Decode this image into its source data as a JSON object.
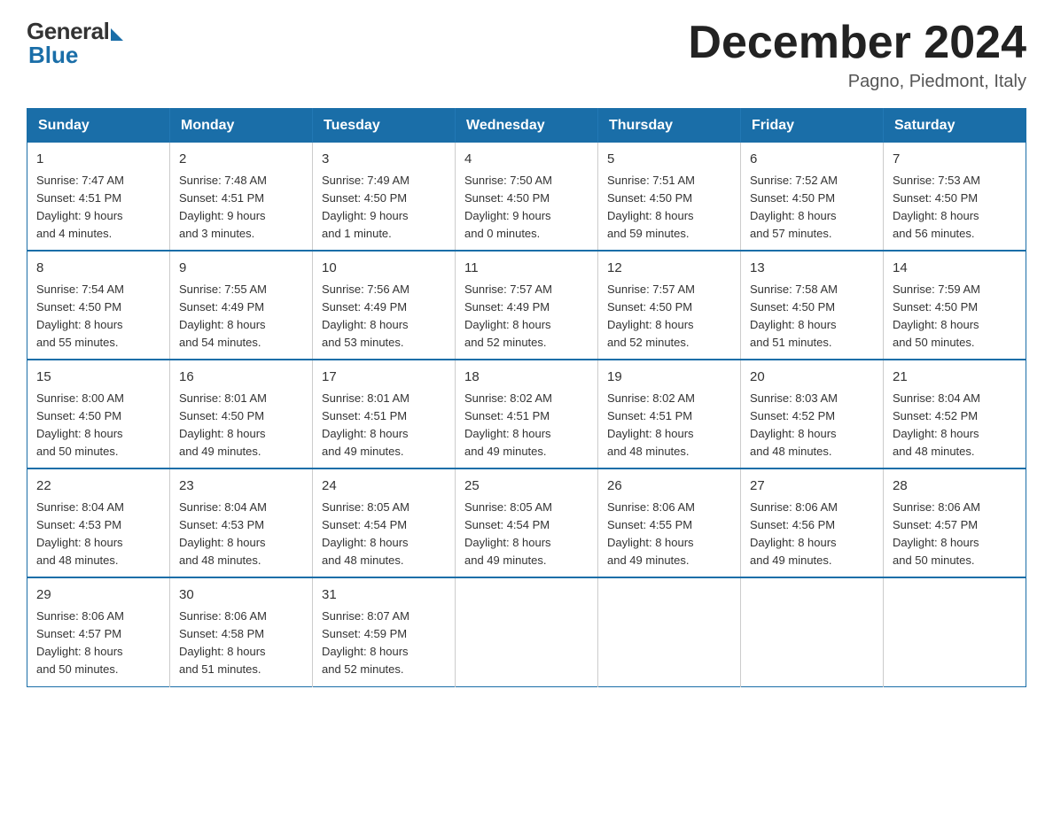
{
  "header": {
    "logo_general": "General",
    "logo_blue": "Blue",
    "title": "December 2024",
    "location": "Pagno, Piedmont, Italy"
  },
  "columns": [
    "Sunday",
    "Monday",
    "Tuesday",
    "Wednesday",
    "Thursday",
    "Friday",
    "Saturday"
  ],
  "weeks": [
    [
      {
        "day": "1",
        "sunrise": "7:47 AM",
        "sunset": "4:51 PM",
        "daylight": "9 hours and 4 minutes."
      },
      {
        "day": "2",
        "sunrise": "7:48 AM",
        "sunset": "4:51 PM",
        "daylight": "9 hours and 3 minutes."
      },
      {
        "day": "3",
        "sunrise": "7:49 AM",
        "sunset": "4:50 PM",
        "daylight": "9 hours and 1 minute."
      },
      {
        "day": "4",
        "sunrise": "7:50 AM",
        "sunset": "4:50 PM",
        "daylight": "9 hours and 0 minutes."
      },
      {
        "day": "5",
        "sunrise": "7:51 AM",
        "sunset": "4:50 PM",
        "daylight": "8 hours and 59 minutes."
      },
      {
        "day": "6",
        "sunrise": "7:52 AM",
        "sunset": "4:50 PM",
        "daylight": "8 hours and 57 minutes."
      },
      {
        "day": "7",
        "sunrise": "7:53 AM",
        "sunset": "4:50 PM",
        "daylight": "8 hours and 56 minutes."
      }
    ],
    [
      {
        "day": "8",
        "sunrise": "7:54 AM",
        "sunset": "4:50 PM",
        "daylight": "8 hours and 55 minutes."
      },
      {
        "day": "9",
        "sunrise": "7:55 AM",
        "sunset": "4:49 PM",
        "daylight": "8 hours and 54 minutes."
      },
      {
        "day": "10",
        "sunrise": "7:56 AM",
        "sunset": "4:49 PM",
        "daylight": "8 hours and 53 minutes."
      },
      {
        "day": "11",
        "sunrise": "7:57 AM",
        "sunset": "4:49 PM",
        "daylight": "8 hours and 52 minutes."
      },
      {
        "day": "12",
        "sunrise": "7:57 AM",
        "sunset": "4:50 PM",
        "daylight": "8 hours and 52 minutes."
      },
      {
        "day": "13",
        "sunrise": "7:58 AM",
        "sunset": "4:50 PM",
        "daylight": "8 hours and 51 minutes."
      },
      {
        "day": "14",
        "sunrise": "7:59 AM",
        "sunset": "4:50 PM",
        "daylight": "8 hours and 50 minutes."
      }
    ],
    [
      {
        "day": "15",
        "sunrise": "8:00 AM",
        "sunset": "4:50 PM",
        "daylight": "8 hours and 50 minutes."
      },
      {
        "day": "16",
        "sunrise": "8:01 AM",
        "sunset": "4:50 PM",
        "daylight": "8 hours and 49 minutes."
      },
      {
        "day": "17",
        "sunrise": "8:01 AM",
        "sunset": "4:51 PM",
        "daylight": "8 hours and 49 minutes."
      },
      {
        "day": "18",
        "sunrise": "8:02 AM",
        "sunset": "4:51 PM",
        "daylight": "8 hours and 49 minutes."
      },
      {
        "day": "19",
        "sunrise": "8:02 AM",
        "sunset": "4:51 PM",
        "daylight": "8 hours and 48 minutes."
      },
      {
        "day": "20",
        "sunrise": "8:03 AM",
        "sunset": "4:52 PM",
        "daylight": "8 hours and 48 minutes."
      },
      {
        "day": "21",
        "sunrise": "8:04 AM",
        "sunset": "4:52 PM",
        "daylight": "8 hours and 48 minutes."
      }
    ],
    [
      {
        "day": "22",
        "sunrise": "8:04 AM",
        "sunset": "4:53 PM",
        "daylight": "8 hours and 48 minutes."
      },
      {
        "day": "23",
        "sunrise": "8:04 AM",
        "sunset": "4:53 PM",
        "daylight": "8 hours and 48 minutes."
      },
      {
        "day": "24",
        "sunrise": "8:05 AM",
        "sunset": "4:54 PM",
        "daylight": "8 hours and 48 minutes."
      },
      {
        "day": "25",
        "sunrise": "8:05 AM",
        "sunset": "4:54 PM",
        "daylight": "8 hours and 49 minutes."
      },
      {
        "day": "26",
        "sunrise": "8:06 AM",
        "sunset": "4:55 PM",
        "daylight": "8 hours and 49 minutes."
      },
      {
        "day": "27",
        "sunrise": "8:06 AM",
        "sunset": "4:56 PM",
        "daylight": "8 hours and 49 minutes."
      },
      {
        "day": "28",
        "sunrise": "8:06 AM",
        "sunset": "4:57 PM",
        "daylight": "8 hours and 50 minutes."
      }
    ],
    [
      {
        "day": "29",
        "sunrise": "8:06 AM",
        "sunset": "4:57 PM",
        "daylight": "8 hours and 50 minutes."
      },
      {
        "day": "30",
        "sunrise": "8:06 AM",
        "sunset": "4:58 PM",
        "daylight": "8 hours and 51 minutes."
      },
      {
        "day": "31",
        "sunrise": "8:07 AM",
        "sunset": "4:59 PM",
        "daylight": "8 hours and 52 minutes."
      },
      null,
      null,
      null,
      null
    ]
  ],
  "labels": {
    "sunrise": "Sunrise:",
    "sunset": "Sunset:",
    "daylight": "Daylight:"
  }
}
